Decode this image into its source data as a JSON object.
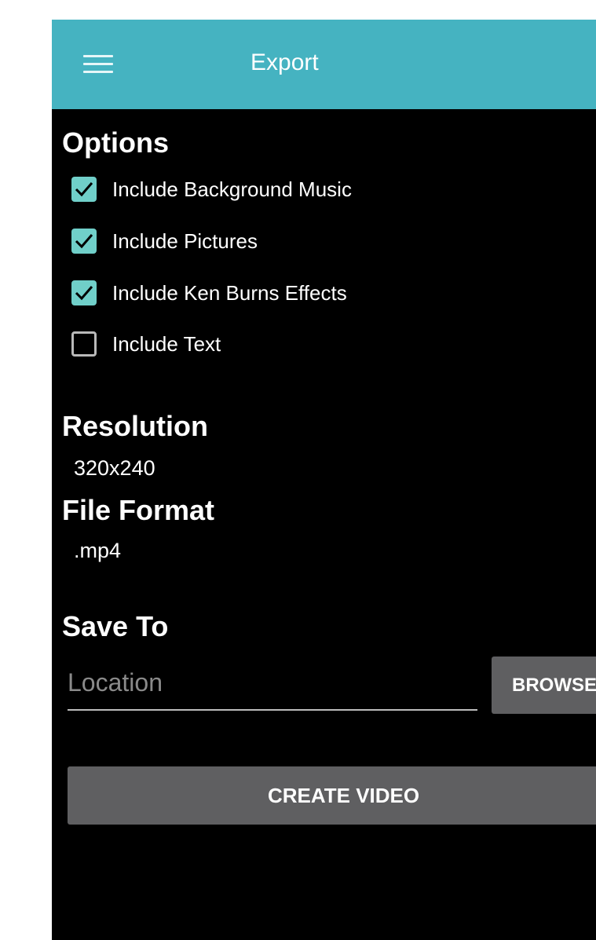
{
  "appbar": {
    "title": "Export",
    "menu_icon": "hamburger-menu-icon",
    "background_color": "#45b3c1"
  },
  "options": {
    "heading": "Options",
    "items": [
      {
        "label": "Include Background Music",
        "checked": true
      },
      {
        "label": "Include Pictures",
        "checked": true
      },
      {
        "label": "Include Ken Burns Effects",
        "checked": true
      },
      {
        "label": "Include Text",
        "checked": false
      }
    ],
    "checked_color": "#70cfc9"
  },
  "resolution": {
    "heading": "Resolution",
    "value": "320x240"
  },
  "file_format": {
    "heading": "File Format",
    "value": ".mp4"
  },
  "save_to": {
    "heading": "Save To",
    "location_placeholder": "Location",
    "location_value": "",
    "browse_label": "BROWSE"
  },
  "create_button_label": "CREATE VIDEO",
  "button_color": "#5f5f61"
}
